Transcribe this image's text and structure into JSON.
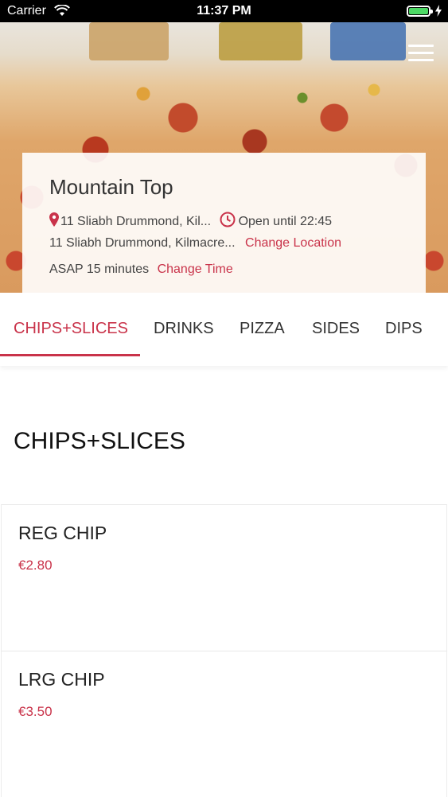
{
  "status_bar": {
    "carrier": "Carrier",
    "time": "11:37 PM"
  },
  "restaurant": {
    "name": "Mountain Top",
    "address_short": "11 Sliabh Drummond, Kil...",
    "hours": "Open until 22:45",
    "address_line": "11 Sliabh Drummond, Kilmacre...",
    "change_location_label": "Change Location",
    "delivery_time": "ASAP 15 minutes",
    "change_time_label": "Change Time"
  },
  "tabs": [
    {
      "label": "CHIPS+SLICES",
      "active": true
    },
    {
      "label": "DRINKS",
      "active": false
    },
    {
      "label": "PIZZA",
      "active": false
    },
    {
      "label": "SIDES",
      "active": false
    },
    {
      "label": "DIPS",
      "active": false
    }
  ],
  "section": {
    "title": "CHIPS+SLICES",
    "items": [
      {
        "name": "REG CHIP",
        "price": "€2.80"
      },
      {
        "name": "LRG CHIP",
        "price": "€3.50"
      }
    ]
  },
  "colors": {
    "accent": "#c9334a",
    "battery": "#4cd964"
  },
  "icons": [
    "wifi-icon",
    "battery-icon",
    "charging-bolt-icon",
    "hamburger-menu-icon",
    "location-pin-icon",
    "clock-icon"
  ]
}
